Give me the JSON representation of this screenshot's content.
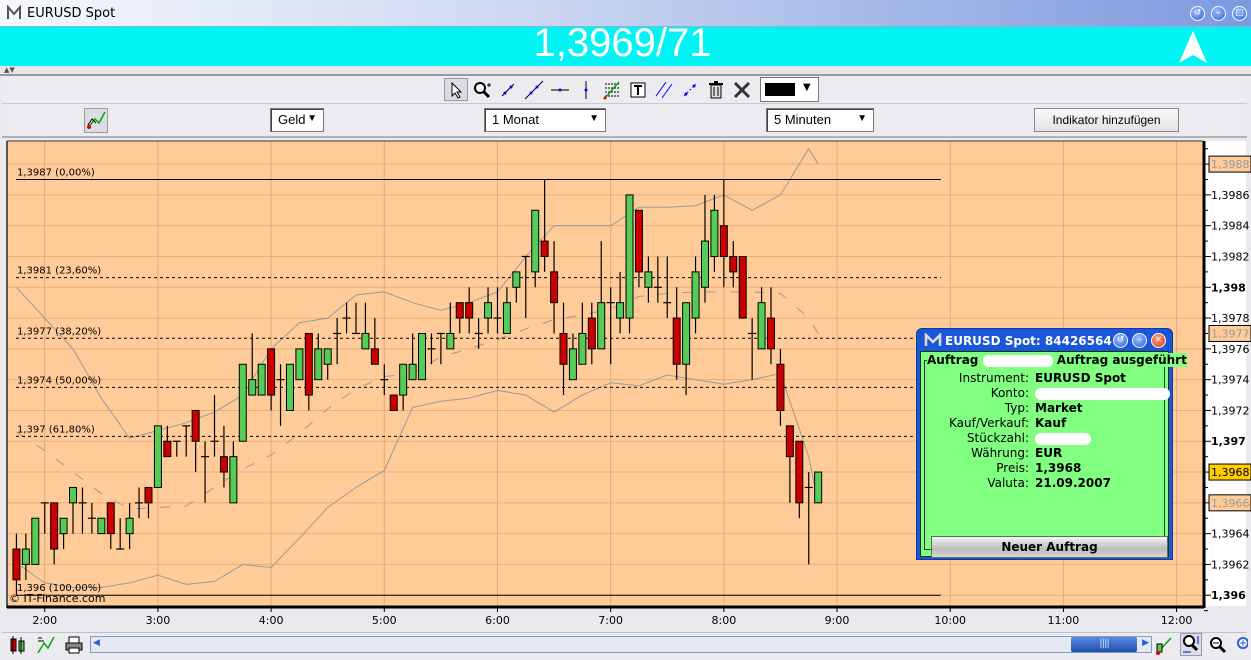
{
  "window": {
    "title": "EURUSD Spot",
    "icon": "m-logo-icon",
    "buttons": [
      "restore-icon",
      "minimize-icon",
      "maximize-icon"
    ]
  },
  "quote": {
    "price": "1,3969/71",
    "direction": "up",
    "banner_color": "#00F4F4"
  },
  "strip": {
    "label": "▲▼"
  },
  "drawing_toolbar": {
    "tools": [
      "pointer-icon",
      "zoom-icon",
      "line-icon",
      "extended-line-icon",
      "horizontal-line-icon",
      "vertical-line-icon",
      "fibonacci-icon",
      "text-icon",
      "parallel-lines-icon",
      "channel-icon",
      "trash-icon",
      "tools-icon"
    ],
    "selected": "pointer-icon",
    "color": "#000000"
  },
  "chart_toolbar": {
    "price_type": "Geld",
    "period": "1 Monat",
    "interval": "5 Minuten",
    "add_indicator": "Indikator hinzufügen"
  },
  "chart_data": {
    "type": "candlestick",
    "xlim": [
      "01:40",
      "12:14"
    ],
    "ylim": [
      1.39593,
      1.39895
    ],
    "grid": true,
    "background": "#FFCC99",
    "colors": {
      "up": "#55CC55",
      "down": "#CC0000",
      "bands": "#9A9A9A"
    },
    "copyright": "© IT-Finance.com",
    "x_ticks": [
      "2:00",
      "3:00",
      "4:00",
      "5:00",
      "6:00",
      "7:00",
      "8:00",
      "9:00",
      "10:00",
      "11:00",
      "12:00"
    ],
    "y_ticks": [
      {
        "label": "1,3986",
        "value": 1.3986
      },
      {
        "label": "1,3984",
        "value": 1.3984
      },
      {
        "label": "1,3982",
        "value": 1.3982
      },
      {
        "label": "1,398",
        "value": 1.398,
        "bold": true
      },
      {
        "label": "1,3978",
        "value": 1.3978
      },
      {
        "label": "1,3976",
        "value": 1.3976
      },
      {
        "label": "1,3974",
        "value": 1.3974
      },
      {
        "label": "1,3972",
        "value": 1.3972
      },
      {
        "label": "1,397",
        "value": 1.397,
        "bold": true
      },
      {
        "label": "1,3964",
        "value": 1.3964
      },
      {
        "label": "1,3962",
        "value": 1.3962
      },
      {
        "label": "1,396",
        "value": 1.396,
        "bold": true
      }
    ],
    "y_markers": [
      {
        "label": "1,3988",
        "value": 1.3988,
        "style": "band"
      },
      {
        "label": "1,3977",
        "value": 1.3977,
        "style": "band"
      },
      {
        "label": "1,3968",
        "value": 1.3968,
        "style": "last"
      },
      {
        "label": "1,3966",
        "value": 1.3966,
        "style": "band"
      }
    ],
    "fibonacci": {
      "high": 1.3987,
      "low": 1.396,
      "levels": [
        {
          "pct": 0,
          "label": "1,3987 (0,00%)",
          "style": "solid"
        },
        {
          "pct": 0.236,
          "label": "1,3981 (23,60%)",
          "style": "dashed"
        },
        {
          "pct": 0.382,
          "label": "1,3977 (38,20%)",
          "style": "dashed"
        },
        {
          "pct": 0.5,
          "label": "1,3974 (50,00%)",
          "style": "dashed"
        },
        {
          "pct": 0.618,
          "label": "1,397 (61,80%)",
          "style": "dashed"
        },
        {
          "pct": 1,
          "label": "1,396 (100,00%)",
          "style": "solid"
        }
      ],
      "end": "09:55"
    },
    "candles_columns": [
      "time",
      "open",
      "high",
      "low",
      "close"
    ],
    "candles": [
      [
        "01:45",
        1.3963,
        1.3964,
        1.396,
        1.3961
      ],
      [
        "01:50",
        1.3962,
        1.3964,
        1.3961,
        1.3963
      ],
      [
        "01:55",
        1.3962,
        1.3965,
        1.3962,
        1.3965
      ],
      [
        "02:00",
        1.3966,
        1.3966,
        1.3964,
        1.3966
      ],
      [
        "02:05",
        1.3966,
        1.3966,
        1.3962,
        1.3963
      ],
      [
        "02:10",
        1.3964,
        1.3965,
        1.3963,
        1.3965
      ],
      [
        "02:15",
        1.3966,
        1.3967,
        1.3964,
        1.3967
      ],
      [
        "02:20",
        1.3966,
        1.3967,
        1.3964,
        1.3966
      ],
      [
        "02:25",
        1.3965,
        1.3966,
        1.3964,
        1.3965
      ],
      [
        "02:30",
        1.3964,
        1.3965,
        1.3964,
        1.3965
      ],
      [
        "02:35",
        1.3966,
        1.3966,
        1.3963,
        1.3964
      ],
      [
        "02:40",
        1.3963,
        1.3965,
        1.3963,
        1.3963
      ],
      [
        "02:45",
        1.3964,
        1.3966,
        1.3963,
        1.3965
      ],
      [
        "02:50",
        1.3966,
        1.3967,
        1.3965,
        1.3966
      ],
      [
        "02:55",
        1.3967,
        1.3967,
        1.3965,
        1.3966
      ],
      [
        "03:00",
        1.3967,
        1.3971,
        1.3967,
        1.3971
      ],
      [
        "03:05",
        1.397,
        1.3971,
        1.3969,
        1.3969
      ],
      [
        "03:10",
        1.397,
        1.397,
        1.3969,
        1.397
      ],
      [
        "03:15",
        1.3971,
        1.3971,
        1.3969,
        1.3971
      ],
      [
        "03:20",
        1.3972,
        1.3972,
        1.3968,
        1.397
      ],
      [
        "03:25",
        1.3969,
        1.397,
        1.3966,
        1.3969
      ],
      [
        "03:30",
        1.397,
        1.3973,
        1.3969,
        1.397
      ],
      [
        "03:35",
        1.3969,
        1.3971,
        1.3967,
        1.3968
      ],
      [
        "03:40",
        1.3966,
        1.397,
        1.3966,
        1.3969
      ],
      [
        "03:45",
        1.397,
        1.3975,
        1.397,
        1.3975
      ],
      [
        "03:50",
        1.3973,
        1.3977,
        1.3973,
        1.3974
      ],
      [
        "03:55",
        1.3973,
        1.3975,
        1.3973,
        1.3975
      ],
      [
        "04:00",
        1.3976,
        1.3976,
        1.3972,
        1.3973
      ],
      [
        "04:05",
        1.3974,
        1.3975,
        1.3971,
        1.3974
      ],
      [
        "04:10",
        1.3972,
        1.3975,
        1.3972,
        1.3975
      ],
      [
        "04:15",
        1.3974,
        1.3976,
        1.3974,
        1.3976
      ],
      [
        "04:20",
        1.3977,
        1.3977,
        1.3972,
        1.3973
      ],
      [
        "04:25",
        1.3974,
        1.3977,
        1.3974,
        1.3976
      ],
      [
        "04:30",
        1.3975,
        1.3976,
        1.3974,
        1.3976
      ],
      [
        "04:35",
        1.3977,
        1.3978,
        1.3975,
        1.3977
      ],
      [
        "04:40",
        1.3978,
        1.3979,
        1.3977,
        1.3978
      ],
      [
        "04:45",
        1.3977,
        1.3979,
        1.3977,
        1.3977
      ],
      [
        "04:50",
        1.3976,
        1.3979,
        1.3976,
        1.3977
      ],
      [
        "04:55",
        1.3976,
        1.3978,
        1.3975,
        1.3975
      ],
      [
        "05:00",
        1.3974,
        1.3975,
        1.3973,
        1.3974
      ],
      [
        "05:05",
        1.3973,
        1.3973,
        1.3972,
        1.3972
      ],
      [
        "05:10",
        1.3973,
        1.3975,
        1.3972,
        1.3975
      ],
      [
        "05:15",
        1.3974,
        1.3977,
        1.3974,
        1.3975
      ],
      [
        "05:20",
        1.3974,
        1.3977,
        1.3974,
        1.3977
      ],
      [
        "05:25",
        1.3976,
        1.3977,
        1.3975,
        1.3976
      ],
      [
        "05:30",
        1.3977,
        1.3977,
        1.3975,
        1.3977
      ],
      [
        "05:35",
        1.3976,
        1.3979,
        1.3976,
        1.3977
      ],
      [
        "05:40",
        1.3979,
        1.3979,
        1.3977,
        1.3978
      ],
      [
        "05:45",
        1.3979,
        1.398,
        1.3977,
        1.3978
      ],
      [
        "05:50",
        1.3977,
        1.3978,
        1.3976,
        1.3977
      ],
      [
        "05:55",
        1.3978,
        1.398,
        1.3977,
        1.3979
      ],
      [
        "06:00",
        1.3978,
        1.398,
        1.3977,
        1.3978
      ],
      [
        "06:05",
        1.3977,
        1.398,
        1.3977,
        1.3979
      ],
      [
        "06:10",
        1.398,
        1.3981,
        1.3979,
        1.3981
      ],
      [
        "06:15",
        1.3982,
        1.3982,
        1.3978,
        1.3982
      ],
      [
        "06:20",
        1.3981,
        1.3985,
        1.398,
        1.3985
      ],
      [
        "06:25",
        1.3983,
        1.3987,
        1.3981,
        1.3982
      ],
      [
        "06:30",
        1.3981,
        1.3983,
        1.3977,
        1.3979
      ],
      [
        "06:35",
        1.3977,
        1.3979,
        1.3973,
        1.3975
      ],
      [
        "06:40",
        1.3974,
        1.3977,
        1.3974,
        1.3976
      ],
      [
        "06:45",
        1.3975,
        1.3979,
        1.3975,
        1.3977
      ],
      [
        "06:50",
        1.3978,
        1.3979,
        1.3975,
        1.3976
      ],
      [
        "06:55",
        1.3976,
        1.3983,
        1.3976,
        1.3979
      ],
      [
        "07:00",
        1.3979,
        1.398,
        1.3975,
        1.3979
      ],
      [
        "07:05",
        1.3978,
        1.3981,
        1.3977,
        1.3979
      ],
      [
        "07:10",
        1.3978,
        1.3986,
        1.3977,
        1.3986
      ],
      [
        "07:15",
        1.3985,
        1.3985,
        1.398,
        1.3981
      ],
      [
        "07:20",
        1.398,
        1.3982,
        1.3979,
        1.3981
      ],
      [
        "07:25",
        1.398,
        1.3982,
        1.3979,
        1.398
      ],
      [
        "07:30",
        1.3979,
        1.3982,
        1.3978,
        1.3979
      ],
      [
        "07:35",
        1.3978,
        1.398,
        1.3974,
        1.3975
      ],
      [
        "07:40",
        1.3975,
        1.3979,
        1.3973,
        1.3979
      ],
      [
        "07:45",
        1.3978,
        1.3982,
        1.3977,
        1.3981
      ],
      [
        "07:50",
        1.398,
        1.3986,
        1.3979,
        1.3983
      ],
      [
        "07:55",
        1.3982,
        1.3986,
        1.3981,
        1.3985
      ],
      [
        "08:00",
        1.3984,
        1.3987,
        1.398,
        1.3982
      ],
      [
        "08:05",
        1.3982,
        1.3983,
        1.398,
        1.3981
      ],
      [
        "08:10",
        1.3982,
        1.3982,
        1.3978,
        1.3978
      ],
      [
        "08:15",
        1.3977,
        1.3978,
        1.3974,
        1.3977
      ],
      [
        "08:20",
        1.3976,
        1.398,
        1.3976,
        1.3979
      ],
      [
        "08:25",
        1.3978,
        1.398,
        1.3975,
        1.3976
      ],
      [
        "08:30",
        1.3975,
        1.3976,
        1.3971,
        1.3972
      ],
      [
        "08:35",
        1.3971,
        1.3971,
        1.3966,
        1.3969
      ],
      [
        "08:40",
        1.397,
        1.397,
        1.3965,
        1.3966
      ],
      [
        "08:45",
        1.3967,
        1.3968,
        1.3962,
        1.3967
      ],
      [
        "08:50",
        1.3966,
        1.3968,
        1.3966,
        1.3968
      ]
    ],
    "bollinger": {
      "times": [
        "01:45",
        "02:00",
        "02:15",
        "02:30",
        "02:45",
        "03:00",
        "03:15",
        "03:30",
        "03:45",
        "04:00",
        "04:15",
        "04:30",
        "04:45",
        "05:00",
        "05:15",
        "05:30",
        "05:45",
        "06:00",
        "06:15",
        "06:30",
        "06:45",
        "07:00",
        "07:15",
        "07:30",
        "07:45",
        "08:00",
        "08:15",
        "08:30",
        "08:45",
        "08:50"
      ],
      "upper": [
        1.398,
        1.3978,
        1.3976,
        1.39728,
        1.39702,
        1.39707,
        1.39712,
        1.39719,
        1.3973,
        1.3976,
        1.39777,
        1.3978,
        1.39795,
        1.39797,
        1.3979,
        1.39785,
        1.3979,
        1.39797,
        1.3982,
        1.3984,
        1.3984,
        1.3984,
        1.39852,
        1.39852,
        1.39853,
        1.3986,
        1.3985,
        1.3986,
        1.3989,
        1.3988
      ],
      "middle": [
        1.39706,
        1.39694,
        1.3968,
        1.39666,
        1.39656,
        1.39657,
        1.39658,
        1.3967,
        1.39682,
        1.39691,
        1.39705,
        1.39721,
        1.39734,
        1.39742,
        1.39744,
        1.39755,
        1.3976,
        1.39766,
        1.39773,
        1.39779,
        1.39782,
        1.39786,
        1.39794,
        1.39796,
        1.39797,
        1.39797,
        1.39797,
        1.39796,
        1.3978,
        1.3977
      ],
      "lower": [
        1.39621,
        1.39608,
        1.39605,
        1.39605,
        1.39608,
        1.39613,
        1.39607,
        1.39609,
        1.3962,
        1.39618,
        1.39637,
        1.39657,
        1.3967,
        1.39681,
        1.39722,
        1.39726,
        1.39728,
        1.39733,
        1.3973,
        1.39719,
        1.3973,
        1.39738,
        1.39736,
        1.39743,
        1.3974,
        1.39737,
        1.3974,
        1.39744,
        1.3969,
        1.3966
      ]
    }
  },
  "order_dialog": {
    "title": "EURUSD Spot: 84426564",
    "group_prefix": "Auftrag",
    "status": "Auftrag ausgeführt",
    "fields": [
      {
        "label": "Instrument:",
        "value": "EURUSD Spot"
      },
      {
        "label": "Konto:",
        "value": null,
        "redacted": true
      },
      {
        "label": "Typ:",
        "value": "Market"
      },
      {
        "label": "Kauf/Verkauf:",
        "value": "Kauf"
      },
      {
        "label": "Stückzahl:",
        "value": null,
        "redacted": true
      },
      {
        "label": "Währung:",
        "value": "EUR"
      },
      {
        "label": "Preis:",
        "value": "1,3968"
      },
      {
        "label": "Valuta:",
        "value": "21.09.2007"
      }
    ],
    "button": "Neuer Auftrag",
    "body_color": "#80FF80"
  },
  "bottom_toolbar": {
    "left_icons": [
      "candle-type-icon",
      "indicator-icon",
      "print-icon"
    ],
    "right_icons": [
      "drawing-icon",
      "zoom-fit-icon",
      "zoom-out-icon",
      "zoom-in-icon"
    ]
  }
}
